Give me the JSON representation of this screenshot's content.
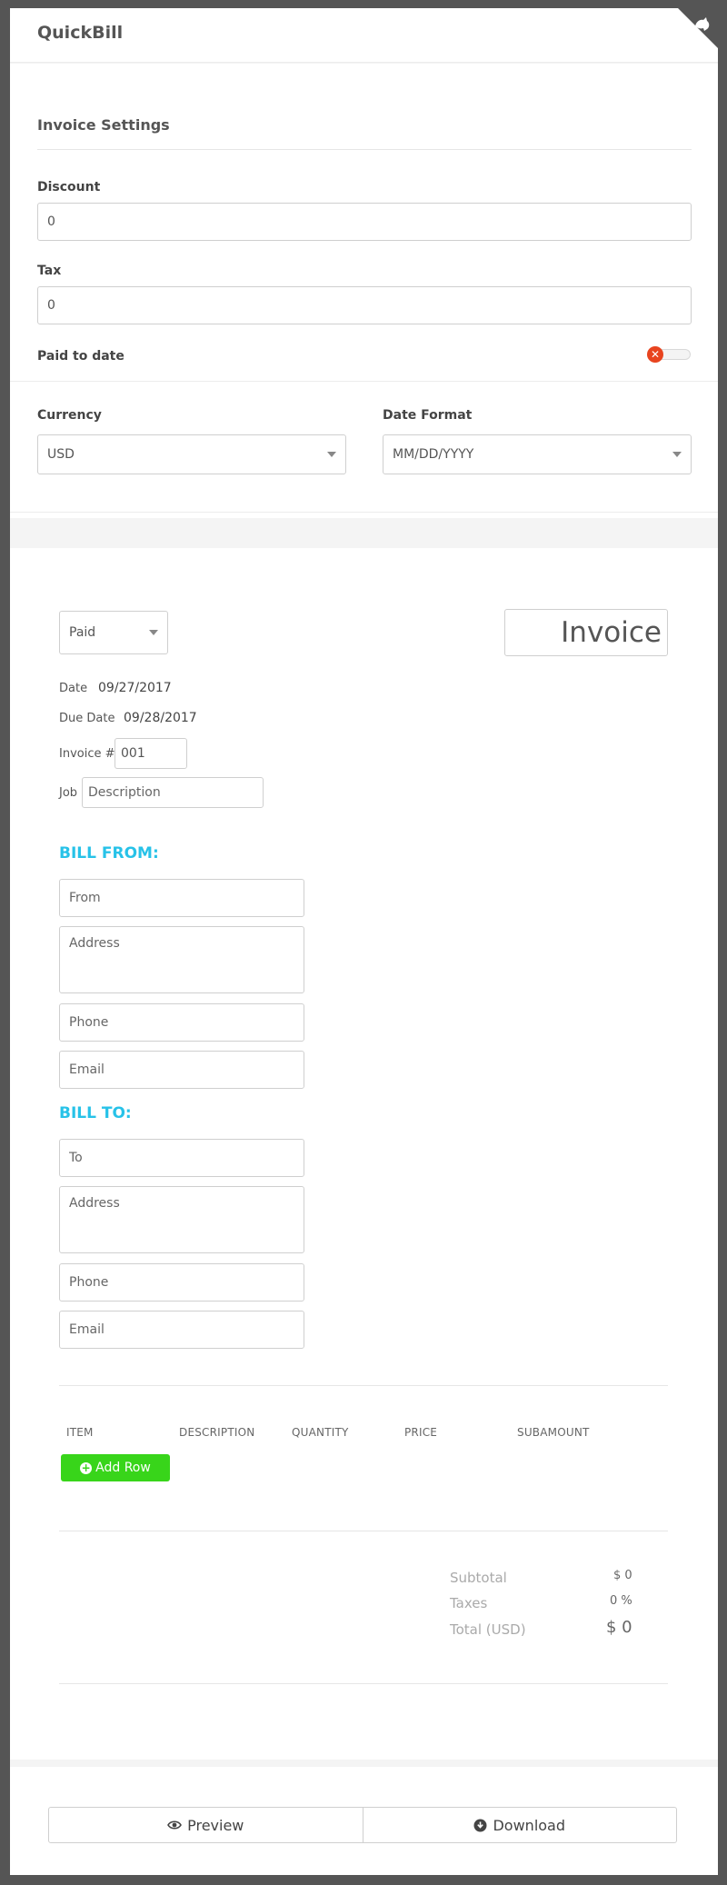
{
  "app": {
    "title": "QuickBill"
  },
  "settings": {
    "title": "Invoice Settings",
    "discount": {
      "label": "Discount",
      "value": "0"
    },
    "tax": {
      "label": "Tax",
      "value": "0"
    },
    "paid_to_date": {
      "label": "Paid to date",
      "enabled": false
    },
    "currency": {
      "label": "Currency",
      "selected": "USD"
    },
    "date_format": {
      "label": "Date Format",
      "selected": "MM/DD/YYYY"
    }
  },
  "invoice": {
    "status_selected": "Paid",
    "title": "Invoice",
    "date": {
      "label": "Date",
      "value": "09/27/2017"
    },
    "due_date": {
      "label": "Due Date",
      "value": "09/28/2017"
    },
    "number": {
      "label": "Invoice #",
      "value": "001"
    },
    "job": {
      "label": "Job",
      "placeholder": "Description"
    },
    "bill_from": {
      "heading": "BILL FROM:",
      "from_placeholder": "From",
      "address_placeholder": "Address",
      "phone_placeholder": "Phone",
      "email_placeholder": "Email"
    },
    "bill_to": {
      "heading": "BILL TO:",
      "to_placeholder": "To",
      "address_placeholder": "Address",
      "phone_placeholder": "Phone",
      "email_placeholder": "Email"
    },
    "table": {
      "columns": [
        "ITEM",
        "DESCRIPTION",
        "QUANTITY",
        "PRICE",
        "SUBAMOUNT"
      ],
      "add_row_label": "Add Row"
    },
    "totals": {
      "subtotal_label": "Subtotal",
      "subtotal_value": "$ 0",
      "taxes_label": "Taxes",
      "taxes_value": "0 %",
      "total_label": "Total (USD)",
      "total_value": "$ 0"
    }
  },
  "footer": {
    "preview_label": "Preview",
    "download_label": "Download"
  },
  "colors": {
    "accent_blue": "#27c2e8",
    "add_green": "#38d51a",
    "toggle_off_red": "#e8441f"
  }
}
